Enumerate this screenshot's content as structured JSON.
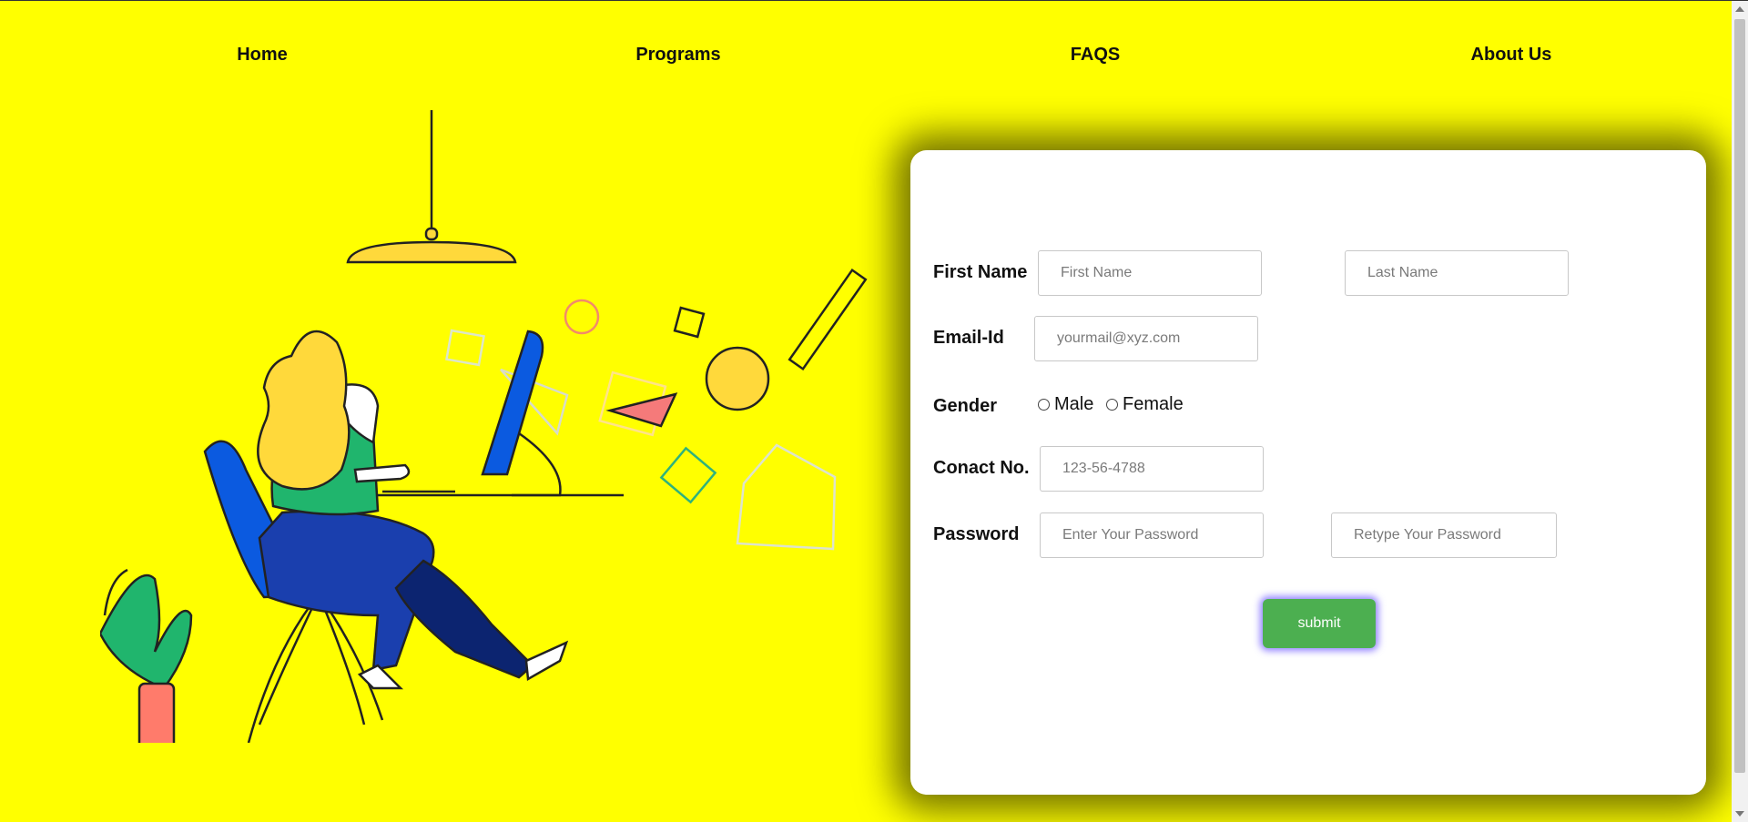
{
  "nav": {
    "items": [
      {
        "label": "Home"
      },
      {
        "label": "Programs"
      },
      {
        "label": "FAQS"
      },
      {
        "label": "About Us"
      }
    ]
  },
  "form": {
    "first_name_label": "First Name",
    "first_name_placeholder": "First Name",
    "last_name_placeholder": "Last Name",
    "email_label": "Email-Id",
    "email_placeholder": "yourmail@xyz.com",
    "gender_label": "Gender",
    "gender_options": [
      "Male",
      "Female"
    ],
    "contact_label": "Conact No.",
    "contact_placeholder": "123-56-4788",
    "password_label": "Password",
    "password_placeholder": "Enter Your Password",
    "retype_placeholder": "Retype Your Password",
    "submit_label": "submit"
  },
  "colors": {
    "background": "#ffff00",
    "submit": "#4caf50"
  },
  "illustration": {
    "icons": [
      "pendant-lamp-icon",
      "woman-at-computer-icon",
      "potted-plant-icon",
      "floating-shapes-icon"
    ]
  }
}
